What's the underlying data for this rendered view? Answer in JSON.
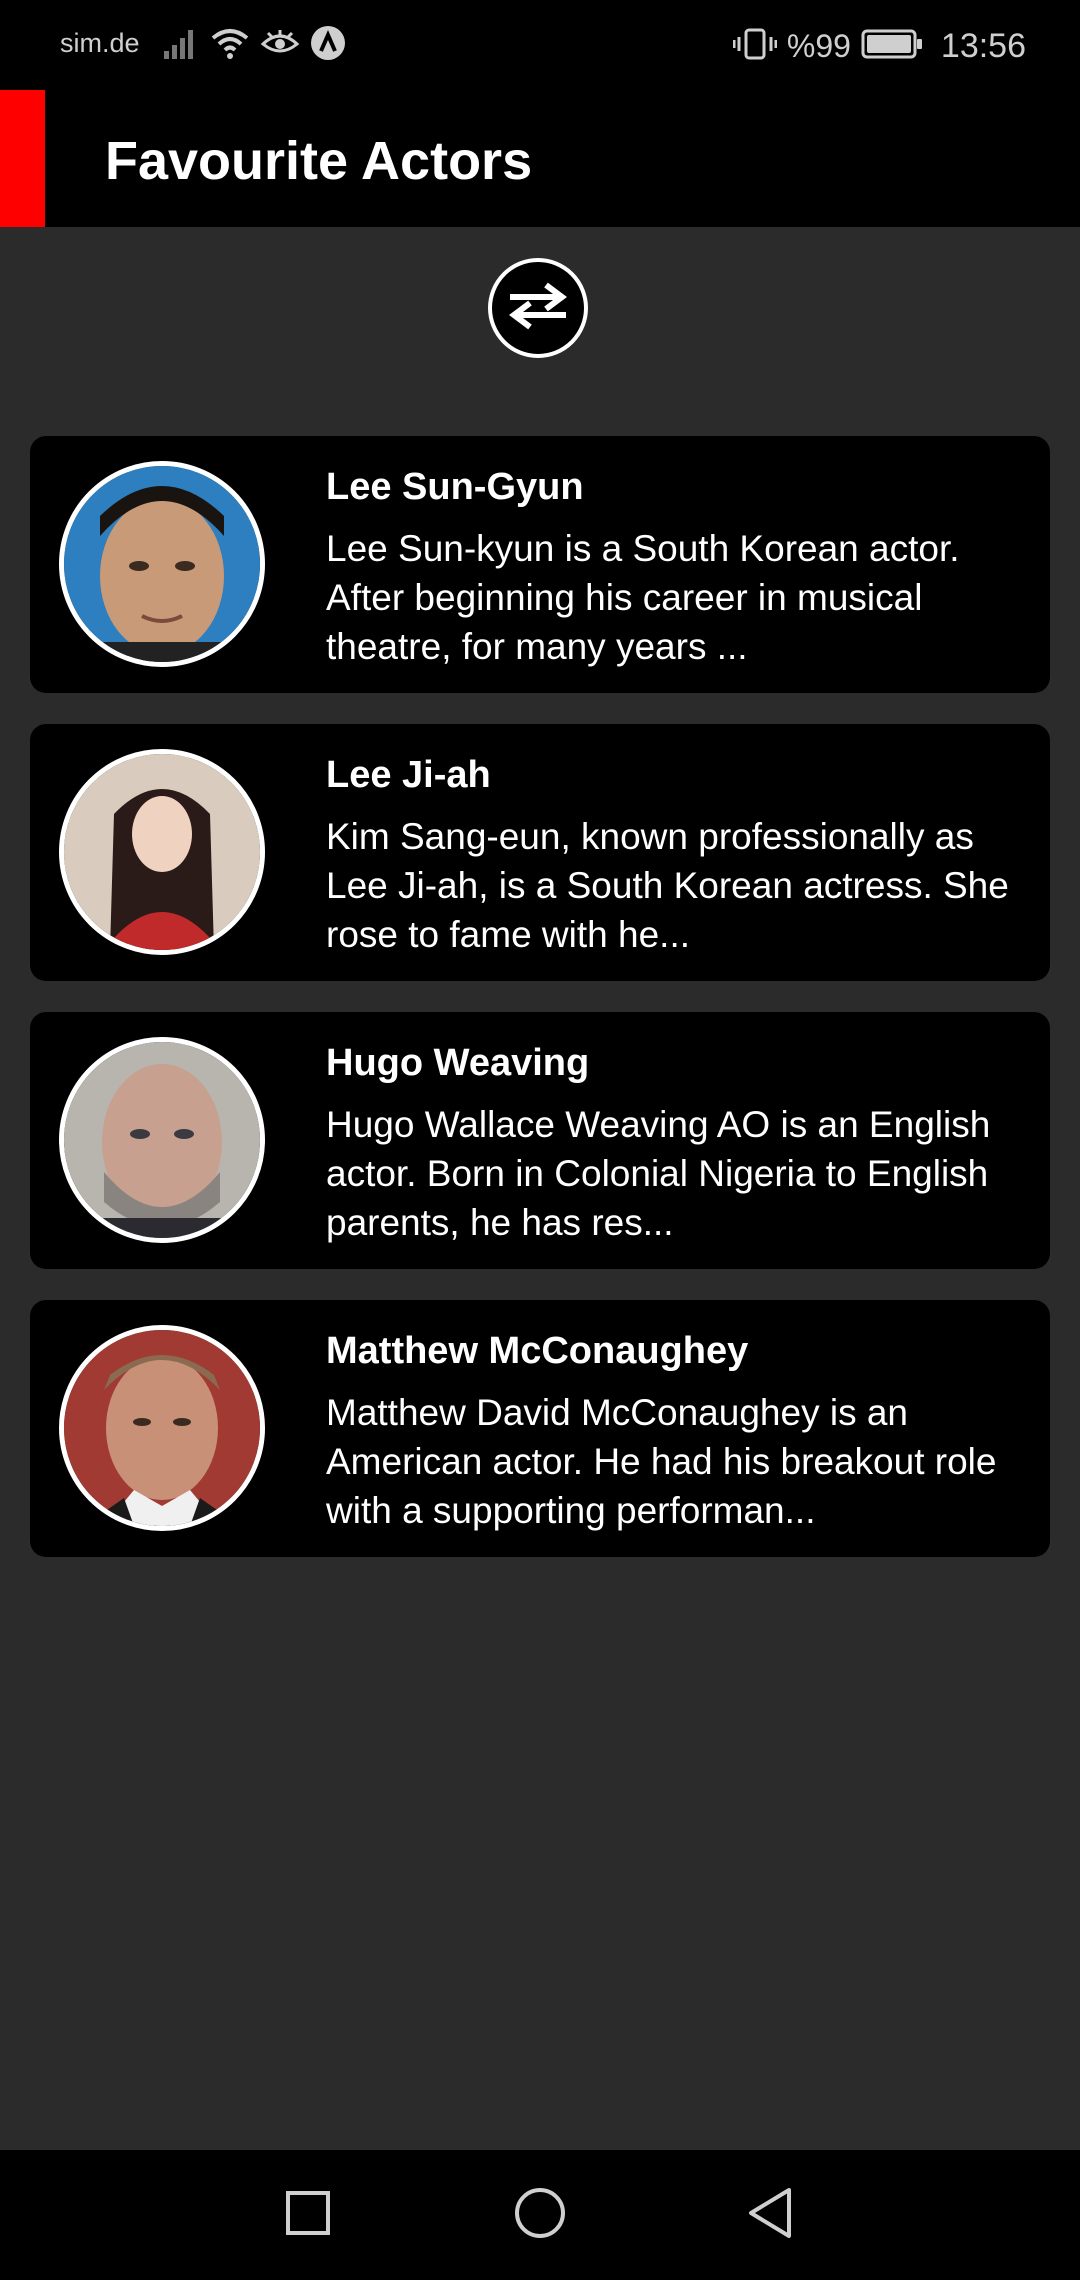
{
  "status_bar": {
    "carrier": "sim.de",
    "battery": "%99",
    "time": "13:56",
    "icons": [
      "signal-icon",
      "wifi-icon",
      "eye-icon",
      "app-icon",
      "vibrate-icon",
      "battery-icon"
    ]
  },
  "header": {
    "title": "Favourite Actors",
    "accent_color": "#ff0000"
  },
  "toolbar": {
    "swap_icon": "swap-arrows-icon"
  },
  "actors": [
    {
      "name": "Lee Sun-Gyun",
      "description": "Lee Sun-kyun is a South Korean actor. After beginning his career in musical theatre, for many years ..."
    },
    {
      "name": "Lee Ji-ah",
      "description": "Kim Sang-eun, known professionally as Lee Ji-ah, is a South Korean actress. She rose to fame with he..."
    },
    {
      "name": "Hugo Weaving",
      "description": "Hugo Wallace Weaving AO is an English actor. Born in Colonial Nigeria to English parents, he has res..."
    },
    {
      "name": "Matthew McConaughey",
      "description": "Matthew David McConaughey is an American actor. He had his breakout role with a supporting performan..."
    }
  ],
  "nav_bar": {
    "icons": [
      "recents-square-icon",
      "home-circle-icon",
      "back-triangle-icon"
    ]
  },
  "colors": {
    "background": "#2b2b2b",
    "card": "#000000",
    "text": "#ffffff"
  }
}
